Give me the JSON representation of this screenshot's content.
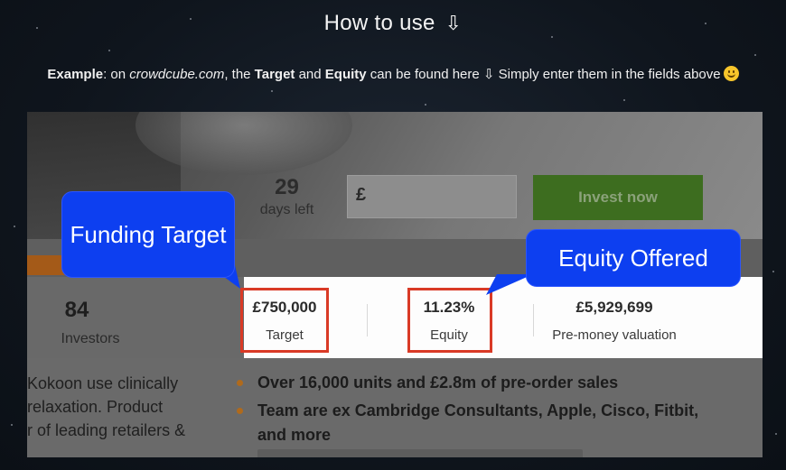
{
  "heading": {
    "text": "How to use",
    "arrow": "⇩"
  },
  "example": {
    "label": "Example",
    "pre": ": on ",
    "site": "crowdcube.com",
    "mid1": ", the ",
    "target": "Target",
    "mid2": " and ",
    "equity": "Equity",
    "post": " can be found here ",
    "arrow": "⇩",
    "tail": " Simply enter them in the fields above",
    "emoji": "slightly-smiling-face-icon"
  },
  "screenshot": {
    "days_number": "29",
    "days_label": "days left",
    "amount_prefix": "£",
    "invest_button": "Invest now",
    "investors_number": "84",
    "investors_label": "Investors",
    "target_value": "£750,000",
    "target_label": "Target",
    "equity_value": "11.23%",
    "equity_label": "Equity",
    "valuation_value": "£5,929,699",
    "valuation_label": "Pre-money valuation",
    "description_lines": [
      "Kokoon use clinically",
      "relaxation. Product",
      "r of leading retailers &"
    ],
    "bullets": [
      "Over 16,000 units and £2.8m of pre-order sales",
      "Team are ex Cambridge Consultants, Apple, Cisco, Fitbit,",
      "and more"
    ]
  },
  "callouts": {
    "funding_target": "Funding Target",
    "equity_offered": "Equity Offered"
  },
  "colors": {
    "callout_blue": "#0d3ff0",
    "highlight_red": "#d93a26",
    "invest_green": "#3d6d1f",
    "background": "#11171f"
  }
}
